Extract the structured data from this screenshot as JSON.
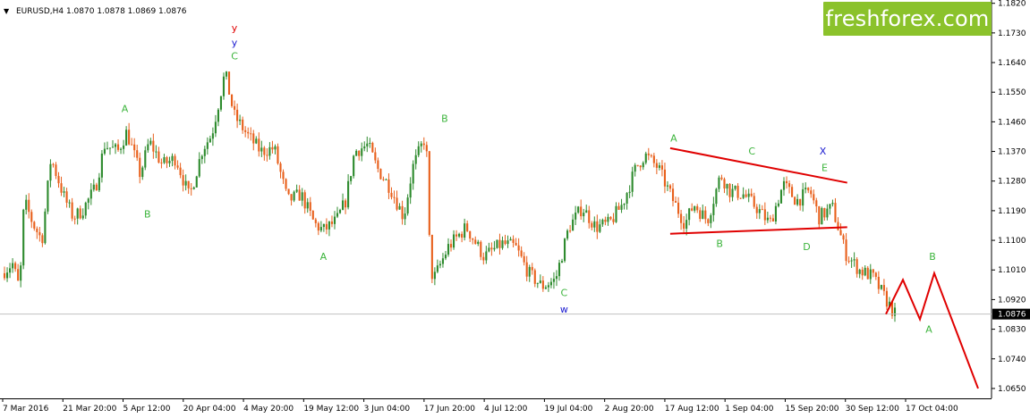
{
  "header": {
    "symbol_line": "EURUSD,H4  1.0870 1.0878 1.0869 1.0876",
    "menu_glyph": "▼"
  },
  "logo": {
    "text": "freshforex.com"
  },
  "colors": {
    "bull": "#2e8b2e",
    "bear": "#e8601c",
    "trend": "#e00000",
    "projection": "#e00000",
    "wave_green": "#3cb43c",
    "wave_blue": "#1a1ad0",
    "wave_red": "#e00000",
    "price_label_bg": "#000000",
    "logo_bg": "#8bc22b"
  },
  "chart_data": {
    "type": "candlestick",
    "symbol": "EURUSD",
    "timeframe": "H4",
    "ohlc": {
      "open": 1.087,
      "high": 1.0878,
      "low": 1.0869,
      "close": 1.0876
    },
    "current_price": "1.0876",
    "ylim": [
      1.062,
      1.183
    ],
    "y_ticks": [
      "1.1820",
      "1.1730",
      "1.1640",
      "1.1550",
      "1.1460",
      "1.1370",
      "1.1280",
      "1.1190",
      "1.1100",
      "1.1010",
      "1.0920",
      "1.0830",
      "1.0740",
      "1.0650"
    ],
    "x_ticks": [
      "7 Mar 2016",
      "21 Mar 20:00",
      "5 Apr 12:00",
      "20 Apr 04:00",
      "4 May 20:00",
      "19 May 12:00",
      "3 Jun 04:00",
      "17 Jun 20:00",
      "4 Jul 12:00",
      "19 Jul 04:00",
      "2 Aug 20:00",
      "17 Aug 12:00",
      "1 Sep 04:00",
      "15 Sep 20:00",
      "30 Sep 12:00",
      "17 Oct 04:00"
    ],
    "price_path": [
      [
        0,
        1.1
      ],
      [
        0.012,
        1.103
      ],
      [
        0.02,
        1.095
      ],
      [
        0.025,
        1.122
      ],
      [
        0.035,
        1.115
      ],
      [
        0.045,
        1.11
      ],
      [
        0.055,
        1.135
      ],
      [
        0.07,
        1.123
      ],
      [
        0.08,
        1.117
      ],
      [
        0.09,
        1.119
      ],
      [
        0.105,
        1.126
      ],
      [
        0.115,
        1.139
      ],
      [
        0.13,
        1.137
      ],
      [
        0.14,
        1.143
      ],
      [
        0.155,
        1.13
      ],
      [
        0.165,
        1.14
      ],
      [
        0.18,
        1.133
      ],
      [
        0.195,
        1.135
      ],
      [
        0.21,
        1.123
      ],
      [
        0.225,
        1.138
      ],
      [
        0.235,
        1.142
      ],
      [
        0.25,
        1.161
      ],
      [
        0.26,
        1.148
      ],
      [
        0.275,
        1.142
      ],
      [
        0.29,
        1.137
      ],
      [
        0.305,
        1.138
      ],
      [
        0.32,
        1.122
      ],
      [
        0.335,
        1.124
      ],
      [
        0.35,
        1.115
      ],
      [
        0.36,
        1.113
      ],
      [
        0.375,
        1.116
      ],
      [
        0.385,
        1.122
      ],
      [
        0.395,
        1.137
      ],
      [
        0.41,
        1.139
      ],
      [
        0.42,
        1.132
      ],
      [
        0.435,
        1.126
      ],
      [
        0.45,
        1.117
      ],
      [
        0.46,
        1.132
      ],
      [
        0.475,
        1.142
      ],
      [
        0.48,
        1.1
      ],
      [
        0.485,
        1.099
      ],
      [
        0.5,
        1.108
      ],
      [
        0.52,
        1.114
      ],
      [
        0.54,
        1.105
      ],
      [
        0.56,
        1.109
      ],
      [
        0.575,
        1.108
      ],
      [
        0.59,
        1.1
      ],
      [
        0.605,
        1.096
      ],
      [
        0.62,
        1.098
      ],
      [
        0.635,
        1.114
      ],
      [
        0.65,
        1.12
      ],
      [
        0.665,
        1.114
      ],
      [
        0.68,
        1.115
      ],
      [
        0.695,
        1.121
      ],
      [
        0.71,
        1.132
      ],
      [
        0.72,
        1.136
      ],
      [
        0.735,
        1.132
      ],
      [
        0.75,
        1.123
      ],
      [
        0.765,
        1.115
      ],
      [
        0.775,
        1.121
      ],
      [
        0.79,
        1.116
      ],
      [
        0.805,
        1.13
      ],
      [
        0.815,
        1.125
      ],
      [
        0.83,
        1.124
      ],
      [
        0.845,
        1.12
      ],
      [
        0.86,
        1.115
      ],
      [
        0.875,
        1.127
      ],
      [
        0.89,
        1.122
      ],
      [
        0.905,
        1.125
      ],
      [
        0.915,
        1.117
      ],
      [
        0.93,
        1.12
      ],
      [
        0.945,
        1.106
      ],
      [
        0.96,
        1.101
      ],
      [
        0.975,
        1.099
      ],
      [
        0.99,
        1.092
      ],
      [
        1.0,
        1.0876
      ]
    ],
    "trendlines": [
      {
        "from": [
          "17 Aug 12:00",
          1.138
        ],
        "to": [
          "30 Sep 12:00",
          1.1275
        ]
      },
      {
        "from": [
          "17 Aug 12:00",
          1.112
        ],
        "to": [
          "30 Sep 12:00",
          1.114
        ]
      }
    ],
    "projection": [
      1.0876,
      1.098,
      1.086,
      1.1,
      1.065
    ],
    "wave_labels": [
      {
        "text": "y",
        "color": "red",
        "anchor": "4 May 20:00",
        "price": 1.1735,
        "size": "large"
      },
      {
        "text": "y",
        "color": "blue",
        "anchor": "4 May 20:00",
        "price": 1.169,
        "size": "medium"
      },
      {
        "text": "C",
        "color": "green",
        "anchor": "4 May 20:00",
        "price": 1.165
      },
      {
        "text": "A",
        "color": "green",
        "anchor": "5 Apr 12:00",
        "price": 1.149
      },
      {
        "text": "B",
        "color": "green",
        "anchor": "20 Apr 04:00",
        "price": 1.117
      },
      {
        "text": "A",
        "color": "green",
        "anchor": "19 May 12:00",
        "price": 1.104
      },
      {
        "text": "B",
        "color": "green",
        "anchor": "17 Jun 20:00",
        "price": 1.146
      },
      {
        "text": "C",
        "color": "green",
        "anchor": "19 Jul 04:00",
        "price": 1.093
      },
      {
        "text": "w",
        "color": "blue",
        "anchor": "19 Jul 04:00",
        "price": 1.088,
        "size": "medium"
      },
      {
        "text": "A",
        "color": "green",
        "anchor": "17 Aug 12:00",
        "price": 1.14
      },
      {
        "text": "B",
        "color": "green",
        "anchor": "1 Sep 04:00",
        "price": 1.108
      },
      {
        "text": "C",
        "color": "green",
        "anchor": "1 Sep 04:00",
        "price": 1.136
      },
      {
        "text": "D",
        "color": "green",
        "anchor": "15 Sep 20:00",
        "price": 1.107
      },
      {
        "text": "E",
        "color": "green",
        "anchor": "15 Sep 20:00",
        "price": 1.131
      },
      {
        "text": "X",
        "color": "blue",
        "anchor": "15 Sep 20:00",
        "price": 1.136,
        "size": "medium"
      },
      {
        "text": "A",
        "color": "green",
        "anchor": "17 Oct 04:00",
        "price": 1.082
      },
      {
        "text": "B",
        "color": "green",
        "anchor": "projection",
        "price": 1.104
      }
    ],
    "grid": false,
    "current_price_line": true
  }
}
